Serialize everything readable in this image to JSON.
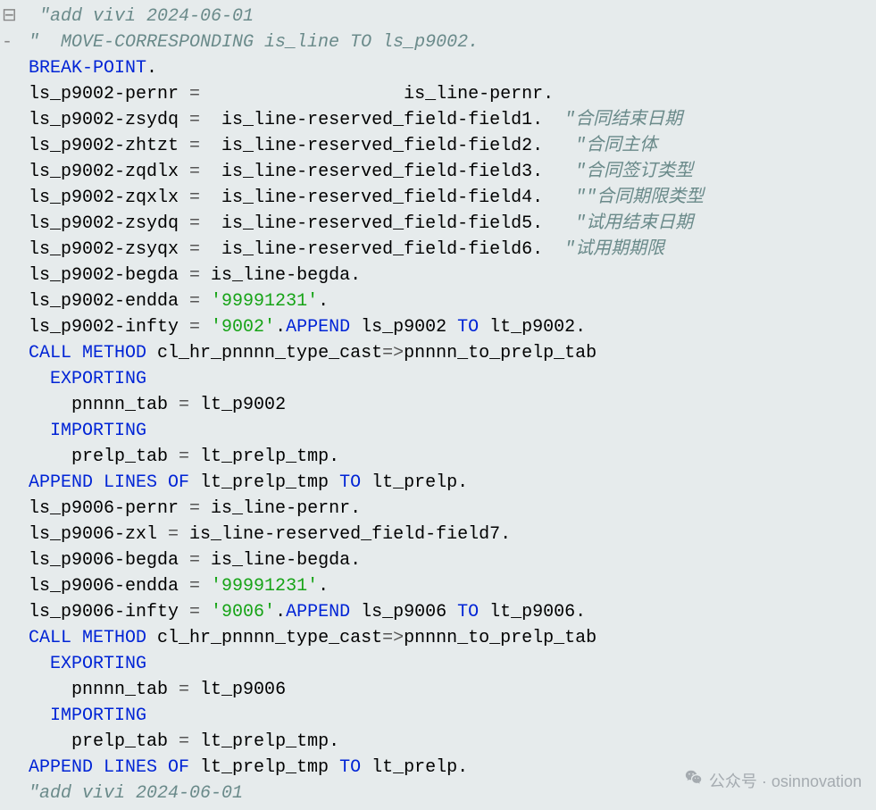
{
  "gutter": [
    "⊟",
    "-"
  ],
  "lines": [
    [
      {
        "c": "cmt",
        "t": "  \"add vivi 2024-06-01"
      }
    ],
    [
      {
        "c": "cmt",
        "t": " \"  MOVE-CORRESPONDING is_line TO ls_p9002."
      }
    ],
    [
      {
        "c": "kw",
        "t": " BREAK-POINT"
      },
      {
        "c": "txt",
        "t": "."
      }
    ],
    [
      {
        "c": "txt",
        "t": " ls_p9002-pernr "
      },
      {
        "c": "op",
        "t": "="
      },
      {
        "c": "txt",
        "t": "                   is_line-pernr."
      }
    ],
    [
      {
        "c": "txt",
        "t": " ls_p9002-zsydq "
      },
      {
        "c": "op",
        "t": "="
      },
      {
        "c": "txt",
        "t": "  is_line-reserved_field-field1.  "
      },
      {
        "c": "cmt",
        "t": "\"合同结束日期"
      }
    ],
    [
      {
        "c": "txt",
        "t": " ls_p9002-zhtzt "
      },
      {
        "c": "op",
        "t": "="
      },
      {
        "c": "txt",
        "t": "  is_line-reserved_field-field2.   "
      },
      {
        "c": "cmt",
        "t": "\"合同主体"
      }
    ],
    [
      {
        "c": "txt",
        "t": " ls_p9002-zqdlx "
      },
      {
        "c": "op",
        "t": "="
      },
      {
        "c": "txt",
        "t": "  is_line-reserved_field-field3.   "
      },
      {
        "c": "cmt",
        "t": "\"合同签订类型"
      }
    ],
    [
      {
        "c": "txt",
        "t": " ls_p9002-zqxlx "
      },
      {
        "c": "op",
        "t": "="
      },
      {
        "c": "txt",
        "t": "  is_line-reserved_field-field4.   "
      },
      {
        "c": "cmt",
        "t": "\"\"合同期限类型"
      }
    ],
    [
      {
        "c": "txt",
        "t": " ls_p9002-zsydq "
      },
      {
        "c": "op",
        "t": "="
      },
      {
        "c": "txt",
        "t": "  is_line-reserved_field-field5.   "
      },
      {
        "c": "cmt",
        "t": "\"试用结束日期"
      }
    ],
    [
      {
        "c": "txt",
        "t": " ls_p9002-zsyqx "
      },
      {
        "c": "op",
        "t": "="
      },
      {
        "c": "txt",
        "t": "  is_line-reserved_field-field6.  "
      },
      {
        "c": "cmt",
        "t": "\"试用期期限"
      }
    ],
    [
      {
        "c": "txt",
        "t": " ls_p9002-begda "
      },
      {
        "c": "op",
        "t": "="
      },
      {
        "c": "txt",
        "t": " is_line-begda."
      }
    ],
    [
      {
        "c": "txt",
        "t": " ls_p9002-endda "
      },
      {
        "c": "op",
        "t": "="
      },
      {
        "c": "str",
        "t": " '99991231'"
      },
      {
        "c": "txt",
        "t": "."
      }
    ],
    [
      {
        "c": "txt",
        "t": " ls_p9002-infty "
      },
      {
        "c": "op",
        "t": "="
      },
      {
        "c": "str",
        "t": " '9002'"
      },
      {
        "c": "txt",
        "t": "."
      },
      {
        "c": "kw",
        "t": "APPEND"
      },
      {
        "c": "txt",
        "t": " ls_p9002 "
      },
      {
        "c": "kw",
        "t": "TO"
      },
      {
        "c": "txt",
        "t": " lt_p9002."
      }
    ],
    [
      {
        "c": "kw",
        "t": " CALL METHOD"
      },
      {
        "c": "txt",
        "t": " cl_hr_pnnnn_type_cast"
      },
      {
        "c": "op",
        "t": "=>"
      },
      {
        "c": "txt",
        "t": "pnnnn_to_prelp_tab"
      }
    ],
    [
      {
        "c": "kw",
        "t": "   EXPORTING"
      }
    ],
    [
      {
        "c": "txt",
        "t": "     pnnnn_tab "
      },
      {
        "c": "op",
        "t": "="
      },
      {
        "c": "txt",
        "t": " lt_p9002"
      }
    ],
    [
      {
        "c": "kw",
        "t": "   IMPORTING"
      }
    ],
    [
      {
        "c": "txt",
        "t": "     prelp_tab "
      },
      {
        "c": "op",
        "t": "="
      },
      {
        "c": "txt",
        "t": " lt_prelp_tmp."
      }
    ],
    [
      {
        "c": "kw",
        "t": " APPEND LINES OF"
      },
      {
        "c": "txt",
        "t": " lt_prelp_tmp "
      },
      {
        "c": "kw",
        "t": "TO"
      },
      {
        "c": "txt",
        "t": " lt_prelp."
      }
    ],
    [
      {
        "c": "txt",
        "t": " ls_p9006-pernr "
      },
      {
        "c": "op",
        "t": "="
      },
      {
        "c": "txt",
        "t": " is_line-pernr."
      }
    ],
    [
      {
        "c": "txt",
        "t": " ls_p9006-zxl "
      },
      {
        "c": "op",
        "t": "="
      },
      {
        "c": "txt",
        "t": " is_line-reserved_field-field7."
      }
    ],
    [
      {
        "c": "txt",
        "t": " ls_p9006-begda "
      },
      {
        "c": "op",
        "t": "="
      },
      {
        "c": "txt",
        "t": " is_line-begda."
      }
    ],
    [
      {
        "c": "txt",
        "t": " ls_p9006-endda "
      },
      {
        "c": "op",
        "t": "="
      },
      {
        "c": "str",
        "t": " '99991231'"
      },
      {
        "c": "txt",
        "t": "."
      }
    ],
    [
      {
        "c": "txt",
        "t": " ls_p9006-infty "
      },
      {
        "c": "op",
        "t": "="
      },
      {
        "c": "str",
        "t": " '9006'"
      },
      {
        "c": "txt",
        "t": "."
      },
      {
        "c": "kw",
        "t": "APPEND"
      },
      {
        "c": "txt",
        "t": " ls_p9006 "
      },
      {
        "c": "kw",
        "t": "TO"
      },
      {
        "c": "txt",
        "t": " lt_p9006."
      }
    ],
    [
      {
        "c": "kw",
        "t": " CALL METHOD"
      },
      {
        "c": "txt",
        "t": " cl_hr_pnnnn_type_cast"
      },
      {
        "c": "op",
        "t": "=>"
      },
      {
        "c": "txt",
        "t": "pnnnn_to_prelp_tab"
      }
    ],
    [
      {
        "c": "kw",
        "t": "   EXPORTING"
      }
    ],
    [
      {
        "c": "txt",
        "t": "     pnnnn_tab "
      },
      {
        "c": "op",
        "t": "="
      },
      {
        "c": "txt",
        "t": " lt_p9006"
      }
    ],
    [
      {
        "c": "kw",
        "t": "   IMPORTING"
      }
    ],
    [
      {
        "c": "txt",
        "t": "     prelp_tab "
      },
      {
        "c": "op",
        "t": "="
      },
      {
        "c": "txt",
        "t": " lt_prelp_tmp."
      }
    ],
    [
      {
        "c": "kw",
        "t": " APPEND LINES OF"
      },
      {
        "c": "txt",
        "t": " lt_prelp_tmp "
      },
      {
        "c": "kw",
        "t": "TO"
      },
      {
        "c": "txt",
        "t": " lt_prelp."
      }
    ],
    [
      {
        "c": "cmt",
        "t": " \"add vivi 2024-06-01"
      }
    ]
  ],
  "watermark": {
    "label": "公众号 · osinnovation"
  }
}
